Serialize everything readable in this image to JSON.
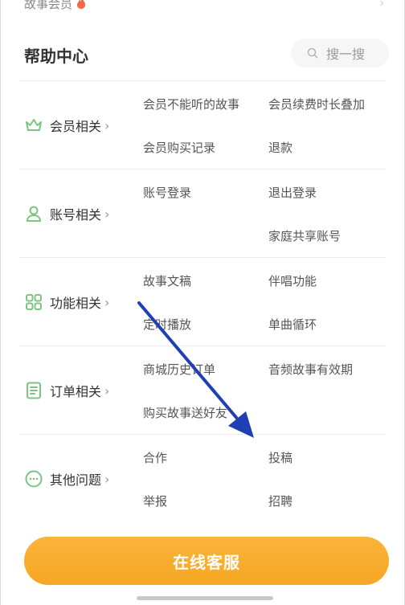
{
  "top_banner": {
    "text": "故事会员"
  },
  "header": {
    "title": "帮助中心",
    "search_placeholder": "搜一搜"
  },
  "sections": [
    {
      "label": "会员相关",
      "icon": "crown-icon",
      "items": [
        "会员不能听的故事",
        "会员续费时长叠加",
        "会员购买记录",
        "退款"
      ]
    },
    {
      "label": "账号相关",
      "icon": "user-icon",
      "items": [
        "账号登录",
        "退出登录",
        "",
        "家庭共享账号"
      ]
    },
    {
      "label": "功能相关",
      "icon": "grid-icon",
      "items": [
        "故事文稿",
        "伴唱功能",
        "定时播放",
        "单曲循环"
      ]
    },
    {
      "label": "订单相关",
      "icon": "order-list-icon",
      "items": [
        "商城历史订单",
        "音频故事有效期",
        "购买故事送好友",
        ""
      ]
    },
    {
      "label": "其他问题",
      "icon": "more-dots-icon",
      "items": [
        "合作",
        "投稿",
        "举报",
        "招聘"
      ]
    }
  ],
  "cta": {
    "label": "在线客服"
  },
  "colors": {
    "accent_green": "#7cc47f",
    "cta_orange": "#f8ac2e",
    "annotation_arrow": "#1f3fb4"
  }
}
